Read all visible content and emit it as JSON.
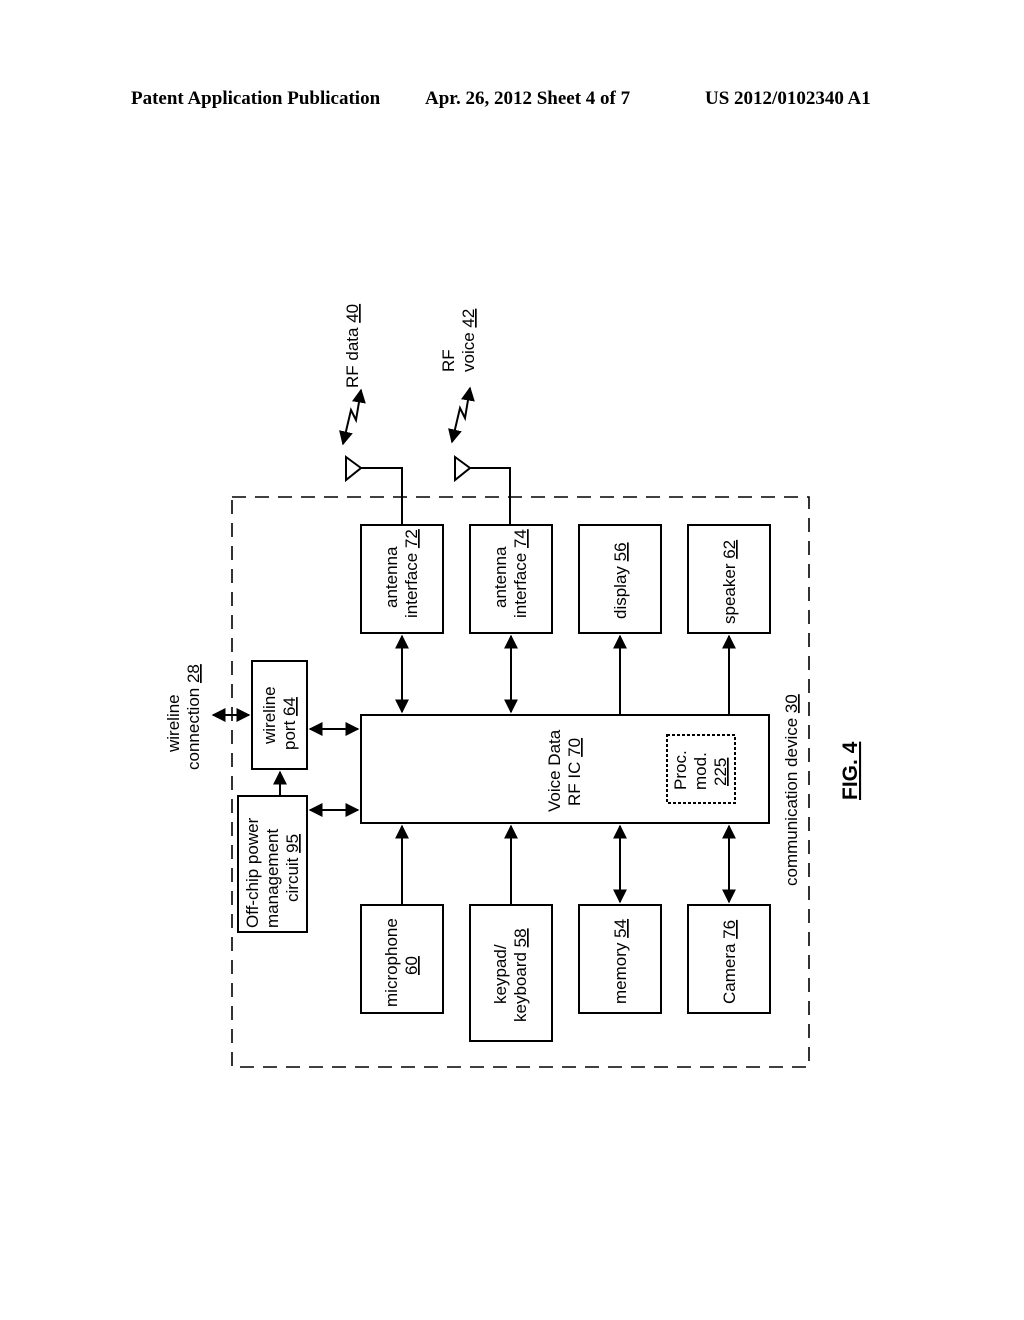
{
  "header": {
    "publication": "Patent Application Publication",
    "date_sheet": "Apr. 26, 2012  Sheet 4 of 7",
    "patent_number": "US 2012/0102340 A1"
  },
  "figure": {
    "label": "FIG. 4",
    "container": {
      "text": "communication device ",
      "ref": "30"
    },
    "signals": {
      "rf_data": {
        "lines": [
          "RF data "
        ],
        "ref": "40"
      },
      "rf_voice": {
        "lines": [
          "RF",
          "voice "
        ],
        "ref": "42"
      },
      "wireline": {
        "lines": [
          "wireline",
          "connection "
        ],
        "ref": "28"
      }
    },
    "blocks": {
      "antenna_interface_72": {
        "lines": [
          "antenna",
          "interface "
        ],
        "ref": "72"
      },
      "antenna_interface_74": {
        "lines": [
          "antenna",
          "interface "
        ],
        "ref": "74"
      },
      "display": {
        "lines": [
          "display "
        ],
        "ref": "56"
      },
      "speaker": {
        "lines": [
          "speaker "
        ],
        "ref": "62"
      },
      "wireline_port": {
        "lines": [
          "wireline",
          "port "
        ],
        "ref": "64"
      },
      "power_mgmt": {
        "lines": [
          "Off-chip power",
          "management",
          "circuit "
        ],
        "ref": "95"
      },
      "rf_ic": {
        "lines": [
          "Voice Data",
          "RF IC "
        ],
        "ref": "70"
      },
      "proc_mod": {
        "lines": [
          "Proc.",
          "mod.",
          ""
        ],
        "ref": "225"
      },
      "microphone": {
        "lines": [
          "microphone",
          ""
        ],
        "ref": "60"
      },
      "keypad": {
        "lines": [
          "keypad/",
          "keyboard "
        ],
        "ref": "58"
      },
      "memory": {
        "lines": [
          "memory "
        ],
        "ref": "54"
      },
      "camera": {
        "lines": [
          "Camera "
        ],
        "ref": "76"
      }
    }
  }
}
